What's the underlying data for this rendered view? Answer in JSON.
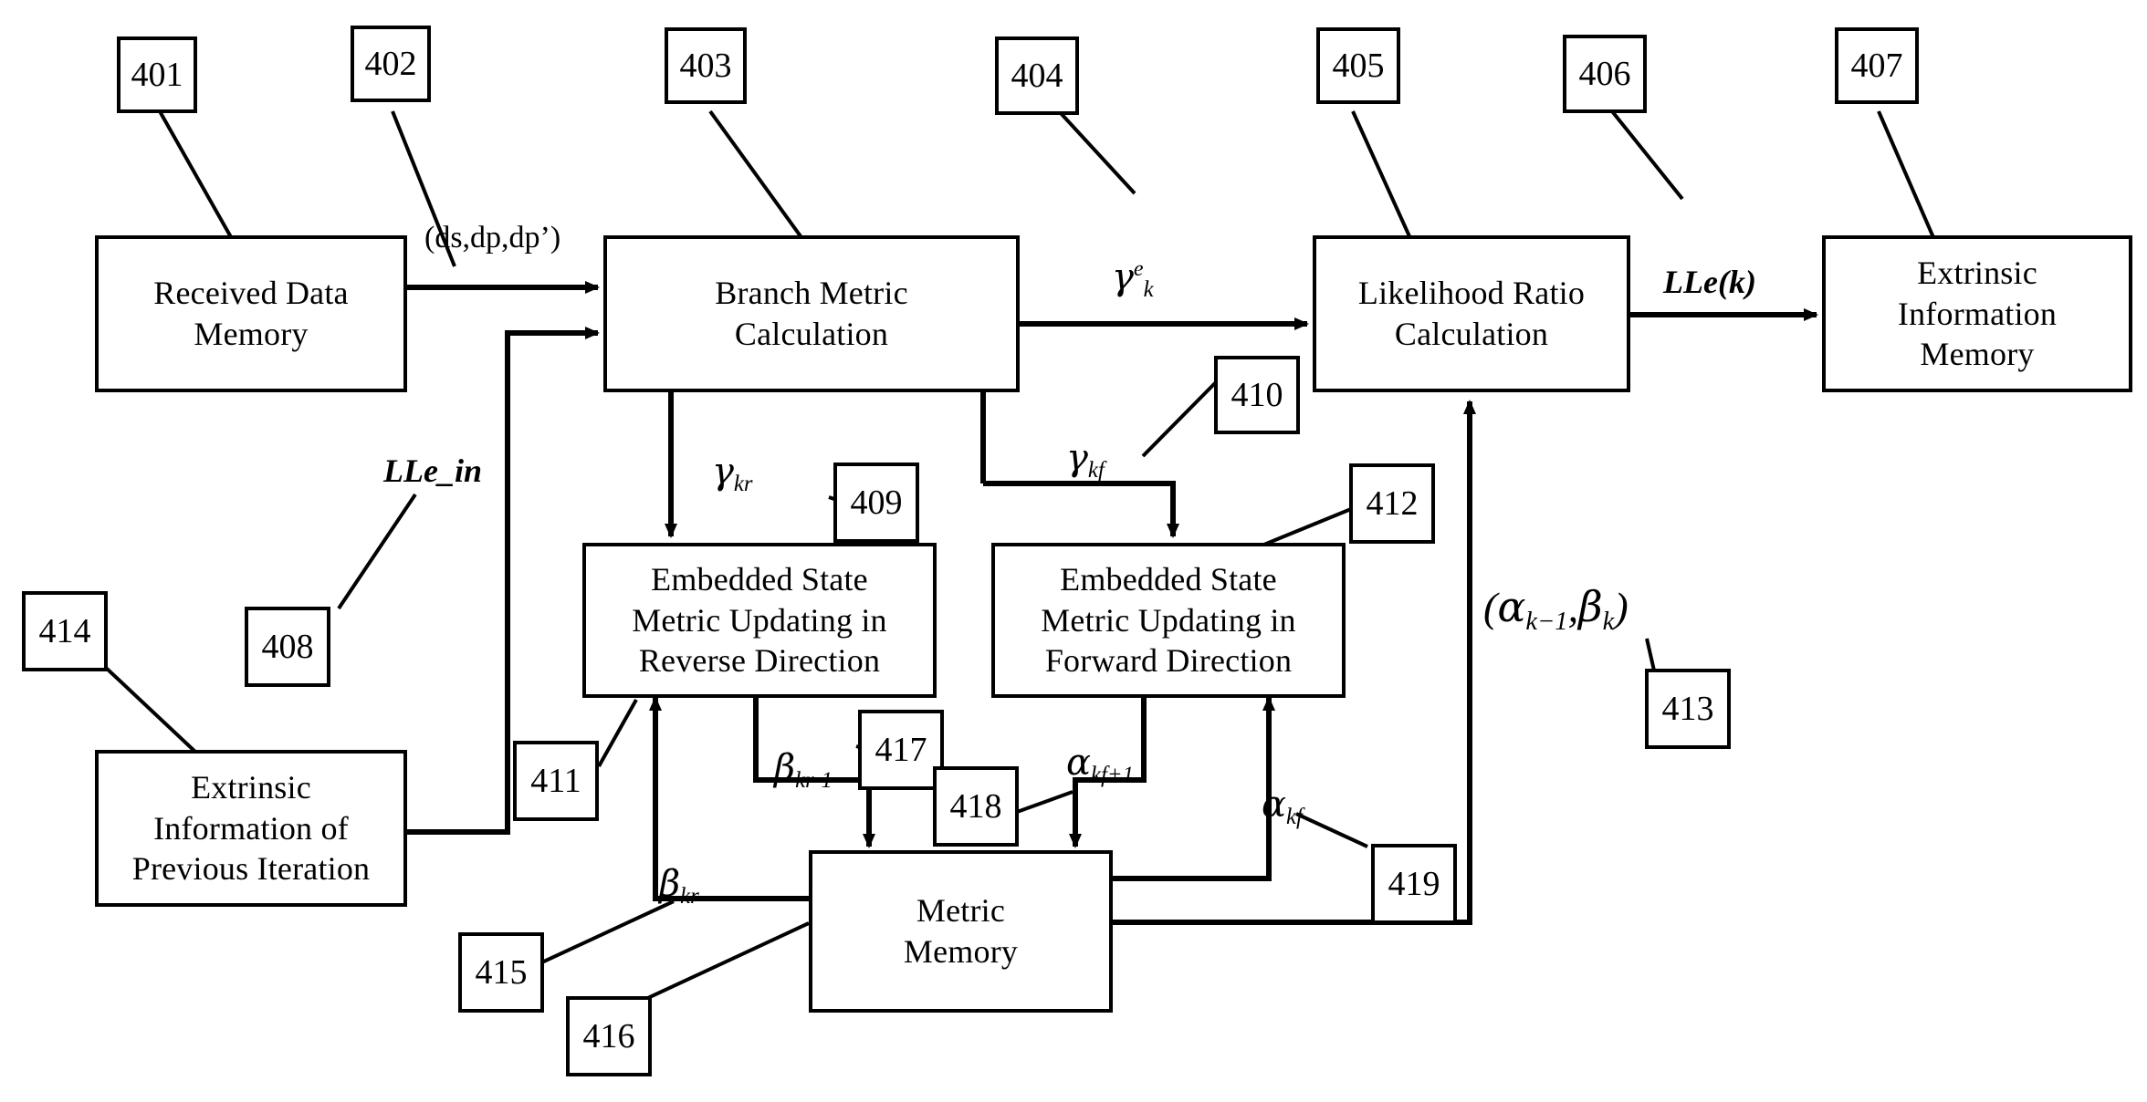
{
  "diagram": {
    "title": "Turbo decoder block diagram",
    "line_color": "#000000",
    "background": "#ffffff"
  },
  "blocks": [
    {
      "id": "received-data-memory",
      "lines": [
        "Received Data",
        "Memory"
      ]
    },
    {
      "id": "branch-metric",
      "lines": [
        "Branch Metric",
        "Calculation"
      ]
    },
    {
      "id": "likelihood-ratio",
      "lines": [
        "Likelihood Ratio",
        "Calculation"
      ]
    },
    {
      "id": "extrinsic-info-memory",
      "lines": [
        "Extrinsic",
        "Information",
        "Memory"
      ]
    },
    {
      "id": "esmu-reverse",
      "lines": [
        "Embedded State",
        "Metric Updating in",
        "Reverse Direction"
      ]
    },
    {
      "id": "esmu-forward",
      "lines": [
        "Embedded State",
        "Metric Updating in",
        "Forward Direction"
      ]
    },
    {
      "id": "extrinsic-info-previous",
      "lines": [
        "Extrinsic",
        "Information of",
        "Previous Iteration"
      ]
    },
    {
      "id": "metric-memory",
      "lines": [
        "Metric",
        "Memory"
      ]
    }
  ],
  "reference_numerals": [
    {
      "id": "ref-401",
      "label": "401"
    },
    {
      "id": "ref-402",
      "label": "402"
    },
    {
      "id": "ref-403",
      "label": "403"
    },
    {
      "id": "ref-404",
      "label": "404"
    },
    {
      "id": "ref-405",
      "label": "405"
    },
    {
      "id": "ref-406",
      "label": "406"
    },
    {
      "id": "ref-407",
      "label": "407"
    },
    {
      "id": "ref-408",
      "label": "408"
    },
    {
      "id": "ref-409",
      "label": "409"
    },
    {
      "id": "ref-410",
      "label": "410"
    },
    {
      "id": "ref-411",
      "label": "411"
    },
    {
      "id": "ref-412",
      "label": "412"
    },
    {
      "id": "ref-413",
      "label": "413"
    },
    {
      "id": "ref-414",
      "label": "414"
    },
    {
      "id": "ref-415",
      "label": "415"
    },
    {
      "id": "ref-416",
      "label": "416"
    },
    {
      "id": "ref-417",
      "label": "417"
    },
    {
      "id": "ref-418",
      "label": "418"
    },
    {
      "id": "ref-419",
      "label": "419"
    }
  ],
  "signal_labels": {
    "ds_dp_dpp": "(ds,dp,dp’)",
    "lle_in": "LLe_in",
    "lle_k": "LLe(k)",
    "gamma_k_e_base": "γ",
    "gamma_k_e_sup": "e",
    "gamma_k_e_sub": "k",
    "gamma_kr_base": "γ",
    "gamma_kr_sub": "kr",
    "gamma_kf_base": "γ",
    "gamma_kf_sub": "kf",
    "beta_kr_base": "β",
    "beta_kr_sub": "kr",
    "beta_krm1_base": "β",
    "beta_krm1_sub": "kr-1",
    "alpha_kf_base": "α",
    "alpha_kf_sub": "kf",
    "alpha_kfp1_base": "α",
    "alpha_kfp1_sub": "kf+1",
    "alpha_beta_open": "(",
    "alpha_beta_alpha": "α",
    "alpha_beta_alpha_sub": "k−1",
    "alpha_beta_comma": ",",
    "alpha_beta_beta": "β",
    "alpha_beta_beta_sub": "k",
    "alpha_beta_close": ")"
  }
}
